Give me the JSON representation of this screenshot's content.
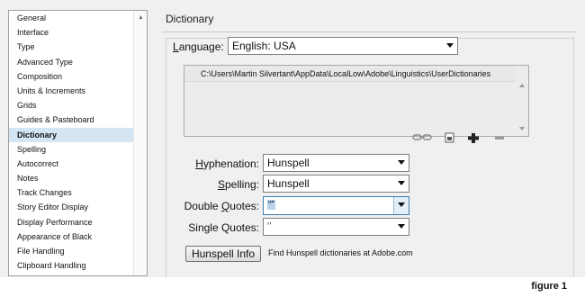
{
  "sidebar": {
    "items": [
      {
        "label": "General"
      },
      {
        "label": "Interface"
      },
      {
        "label": "Type"
      },
      {
        "label": "Advanced Type"
      },
      {
        "label": "Composition"
      },
      {
        "label": "Units & Increments"
      },
      {
        "label": "Grids"
      },
      {
        "label": "Guides & Pasteboard"
      },
      {
        "label": "Dictionary",
        "selected": true
      },
      {
        "label": "Spelling"
      },
      {
        "label": "Autocorrect"
      },
      {
        "label": "Notes"
      },
      {
        "label": "Track Changes"
      },
      {
        "label": "Story Editor Display"
      },
      {
        "label": "Display Performance"
      },
      {
        "label": "Appearance of Black"
      },
      {
        "label": "File Handling"
      },
      {
        "label": "Clipboard Handling"
      }
    ]
  },
  "main": {
    "title": "Dictionary",
    "language": {
      "label": "Language:",
      "value": "English: USA"
    },
    "dictionary_path": "C:\\Users\\Martin Silvertant\\AppData\\LocalLow\\Adobe\\Linguistics\\UserDictionaries",
    "hyphenation": {
      "label": "Hyphenation:",
      "value": "Hunspell"
    },
    "spelling": {
      "label": "Spelling:",
      "value": "Hunspell"
    },
    "double_quotes": {
      "label": "Double Quotes:",
      "value": "“”"
    },
    "single_quotes": {
      "label": "Single Quotes:",
      "value": "‘’"
    },
    "hunspell_button": "Hunspell Info",
    "find_text": "Find Hunspell dictionaries at Adobe.com"
  },
  "caption": "figure 1",
  "colors": {
    "selected_bg": "#d4e6f4",
    "panel_bg": "#f0f0f0",
    "focus_border": "#3c7fb1"
  }
}
